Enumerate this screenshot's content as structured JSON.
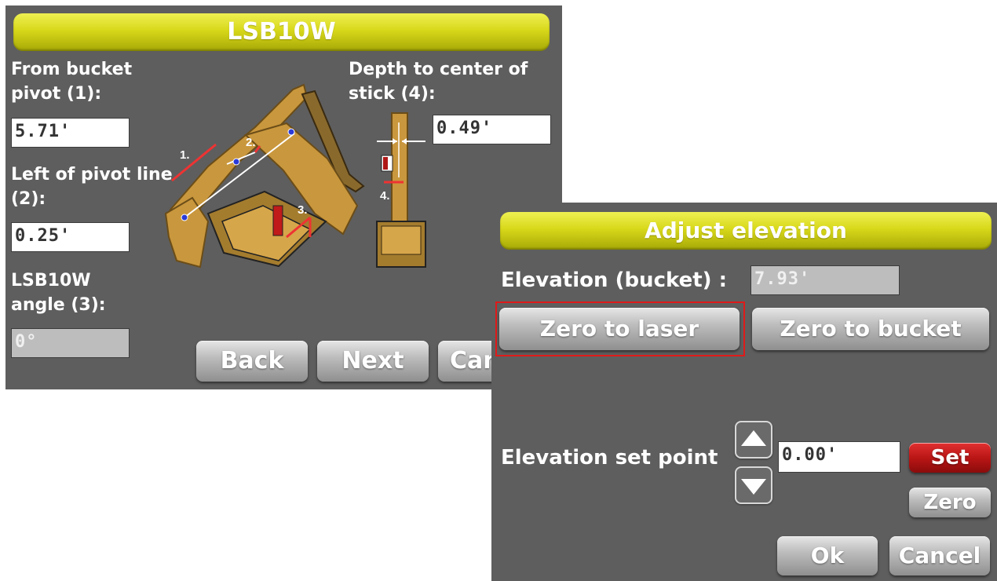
{
  "screen1": {
    "title": "LSB10W",
    "from_pivot_label": [
      "From bucket",
      "pivot (1):"
    ],
    "from_pivot_value": "5.71'",
    "left_pivot_label": [
      "Left of pivot line",
      "(2):"
    ],
    "left_pivot_value": "0.25'",
    "angle_label": [
      "LSB10W",
      "angle (3):"
    ],
    "angle_value": "0°",
    "depth_label": [
      "Depth to center of",
      "stick (4):"
    ],
    "depth_value": "0.49'",
    "diagram_markers": [
      "1.",
      "2.",
      "3.",
      "4."
    ],
    "buttons": {
      "back": "Back",
      "next": "Next",
      "cancel": "Cancel"
    }
  },
  "screen2": {
    "title": "Adjust elevation",
    "elevation_label": "Elevation (bucket) :",
    "elevation_value": "7.93'",
    "zero_to_laser": "Zero to laser",
    "zero_to_bucket": "Zero to bucket",
    "setpoint_label": "Elevation set point",
    "setpoint_value": "0.00'",
    "set_button": "Set",
    "zero_button": "Zero",
    "ok_button": "Ok",
    "cancel_button": "Cancel"
  },
  "colors": {
    "panel_bg": "#5e5e5e",
    "title_yellow": "#d8d81a",
    "highlight_red": "#e01a1a",
    "set_red": "#b61414",
    "machine_tan": "#c9973d"
  },
  "icons": {
    "up": "up-arrow-icon",
    "down": "down-arrow-icon"
  }
}
